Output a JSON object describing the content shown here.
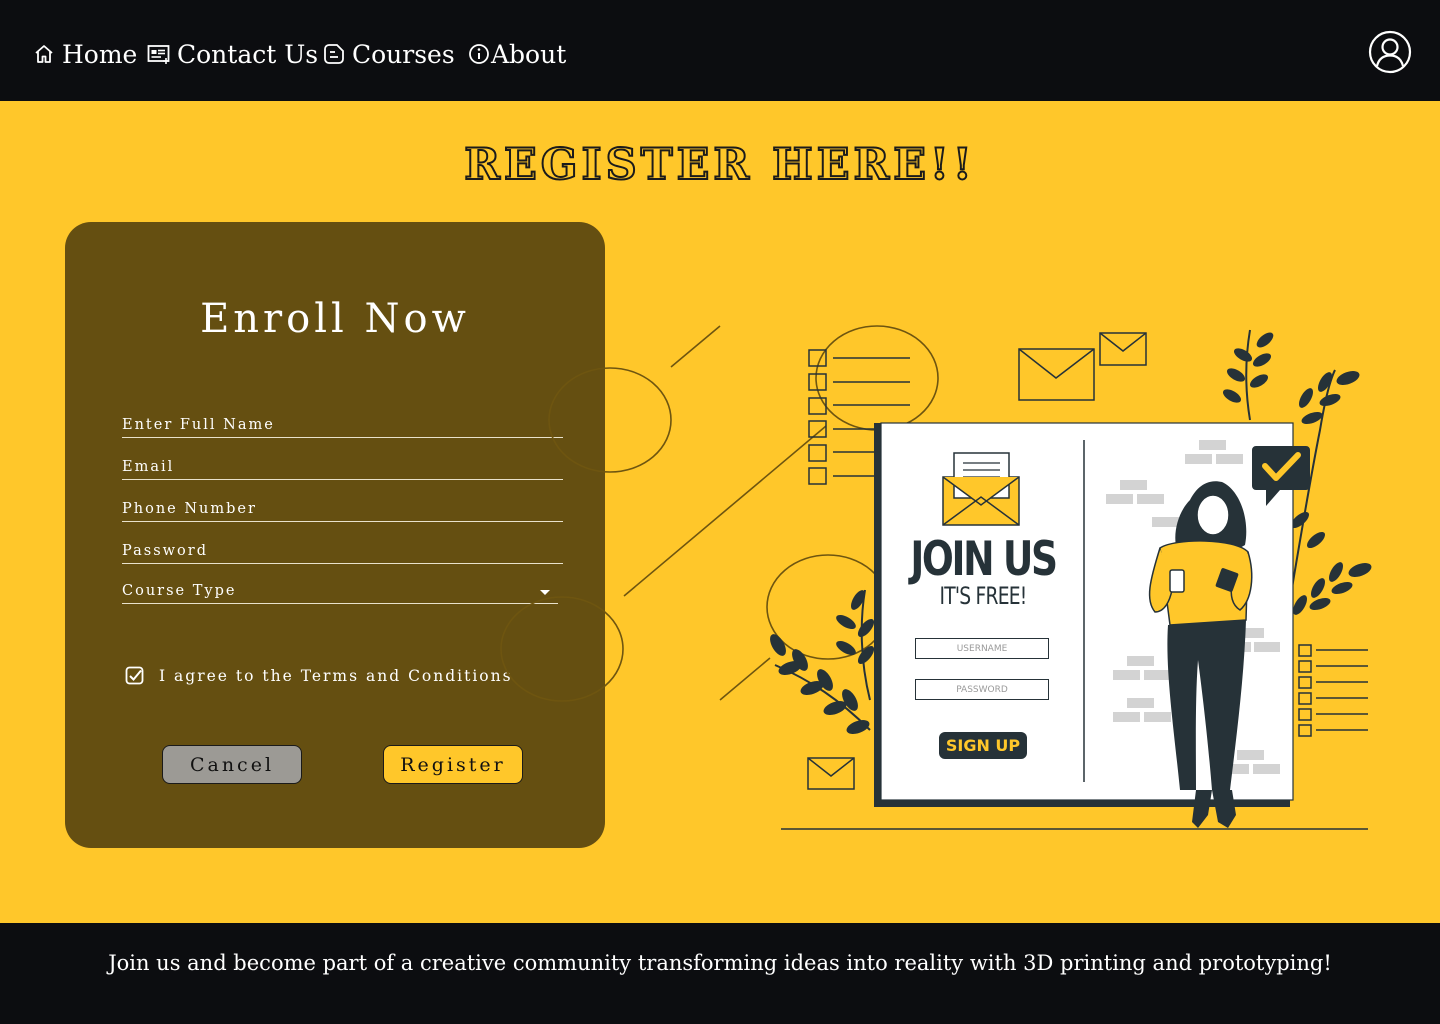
{
  "nav": {
    "items": [
      {
        "label": "Home",
        "icon": "home-icon"
      },
      {
        "label": "Contact Us",
        "icon": "contact-card-icon"
      },
      {
        "label": "Courses",
        "icon": "courses-icon"
      },
      {
        "label": "About",
        "icon": "info-icon"
      }
    ],
    "profile_icon": "user-profile-icon"
  },
  "heading": "REGISTER HERE!!",
  "form": {
    "title": "Enroll Now",
    "fields": [
      {
        "label": "Enter Full Name"
      },
      {
        "label": "Email"
      },
      {
        "label": "Phone Number"
      },
      {
        "label": "Password"
      }
    ],
    "select": {
      "label": "Course Type"
    },
    "terms": {
      "label": "I agree to the Terms and Conditions",
      "checked": true
    },
    "cancel_label": "Cancel",
    "register_label": "Register"
  },
  "illustration": {
    "title": "JOIN US",
    "subtitle": "IT'S FREE!",
    "username_placeholder": "USERNAME",
    "password_placeholder": "PASSWORD",
    "signup_label": "SIGN UP"
  },
  "footer": {
    "text": "Join us and become part of a creative community transforming ideas into reality with 3D printing and prototyping!"
  },
  "colors": {
    "background": "#ffc72a",
    "navbar": "#0c0d10",
    "card": "#654f11",
    "ink": "#263238"
  }
}
